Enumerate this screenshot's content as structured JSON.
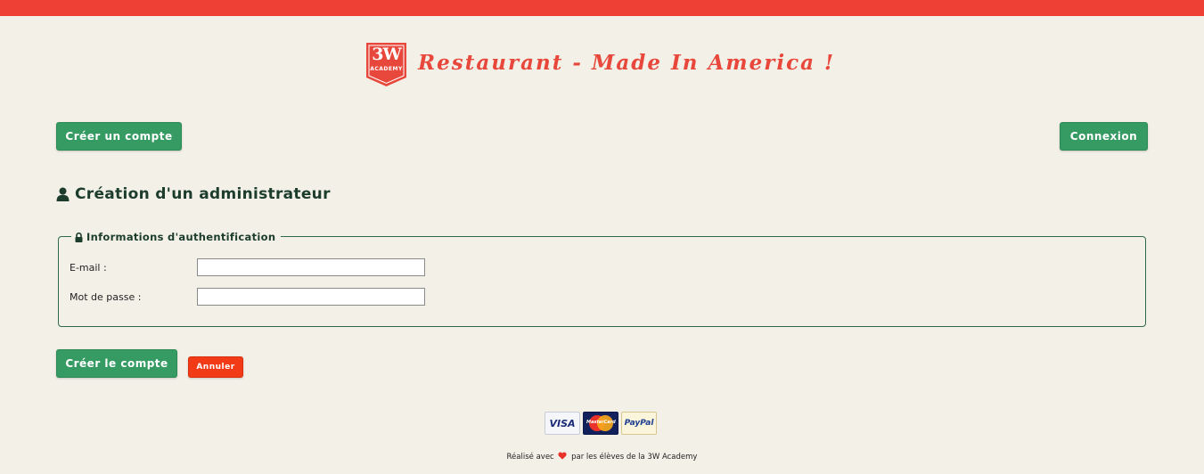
{
  "header": {
    "logo": {
      "main": "3W",
      "sub": "ACADEMY"
    },
    "title": "Restaurant - Made In America !",
    "brand_color": "#ef4036"
  },
  "nav": {
    "create_account_label": "Créer un compte",
    "login_label": "Connexion"
  },
  "main": {
    "heading": "Création d'un administrateur",
    "heading_icon": "user-icon",
    "fieldset": {
      "legend": "Informations d'authentification",
      "legend_icon": "lock-icon",
      "email_label": "E-mail :",
      "email_value": "",
      "password_label": "Mot de passe :",
      "password_value": ""
    },
    "submit_label": "Créer le compte",
    "cancel_label": "Annuler"
  },
  "payments": {
    "visa": "VISA",
    "mastercard": "MasterCard",
    "paypal": "PayPal"
  },
  "footer": {
    "prefix": "Réalisé avec",
    "suffix": "par les élèves de la 3W Academy",
    "heart_icon": "heart-icon"
  },
  "colors": {
    "accent_green": "#359b63",
    "cancel_red": "#f23a16",
    "background": "#f3f0e8"
  }
}
